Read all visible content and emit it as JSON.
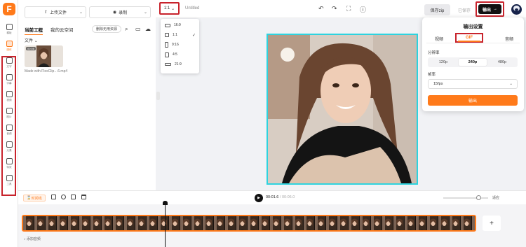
{
  "app": {
    "logo_letter": "F",
    "brand_color": "#ff7a1a",
    "canvas_border_color": "#2ed3df",
    "highlight_color": "#c8232c"
  },
  "rail": {
    "items": [
      {
        "label": "模板",
        "icon": "template-icon"
      },
      {
        "label": "媒体",
        "icon": "media-icon"
      },
      {
        "label": "文字",
        "icon": "text-icon"
      },
      {
        "label": "字幕",
        "icon": "subtitle-icon"
      },
      {
        "label": "视频",
        "icon": "video-icon"
      },
      {
        "label": "图片",
        "icon": "image-icon"
      },
      {
        "label": "音频",
        "icon": "audio-icon"
      },
      {
        "label": "元素",
        "icon": "elements-icon"
      },
      {
        "label": "特效",
        "icon": "effects-icon"
      },
      {
        "label": "工具",
        "icon": "tools-icon"
      }
    ]
  },
  "panel": {
    "upload_label": "上传文件",
    "record_label": "录制",
    "tabs": [
      "当前工程",
      "我的云空间"
    ],
    "clean_label": "删除无用资源",
    "files_label": "文件",
    "media_badge": "00:06",
    "media_name": "Made with FlexClip…6.mp4"
  },
  "topbar": {
    "ratio_value": "1:1",
    "project_name": "Untitled",
    "save_zip_label": "保存zip",
    "saved_label": "已保存",
    "export_label": "输出"
  },
  "ratio_menu": {
    "options": [
      "16:9",
      "1:1",
      "9:16",
      "4:5",
      "21:9"
    ],
    "selected": "1:1"
  },
  "export_panel": {
    "title": "输出设置",
    "tabs": [
      "视频",
      "GIF",
      "音频"
    ],
    "selected_tab": "GIF",
    "resolution_label": "分辨率",
    "resolutions": [
      "120p",
      "240p",
      "480p"
    ],
    "selected_resolution": "240p",
    "fps_label": "帧率",
    "fps_value": "15fps",
    "export_button_label": "输出"
  },
  "timeline": {
    "timeline_button_label": "时间线",
    "current_time": "00:01.6",
    "total_time": "/ 00:06.0",
    "fit_label": "适应",
    "add_audio_label": "添加音频",
    "add_clip_label": "+"
  }
}
